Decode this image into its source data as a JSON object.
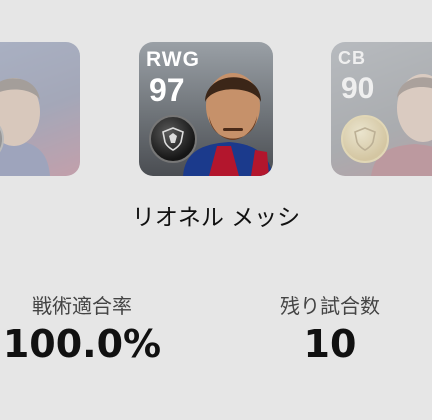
{
  "cards": {
    "left": {
      "position": "",
      "rating": ""
    },
    "center": {
      "position": "RWG",
      "rating": "97"
    },
    "right": {
      "position": "CB",
      "rating": "90"
    }
  },
  "player_name": "リオネル メッシ",
  "stats": [
    {
      "label": "戦術適合率",
      "value": "100.0%"
    },
    {
      "label": "残り試合数",
      "value": "10"
    }
  ]
}
